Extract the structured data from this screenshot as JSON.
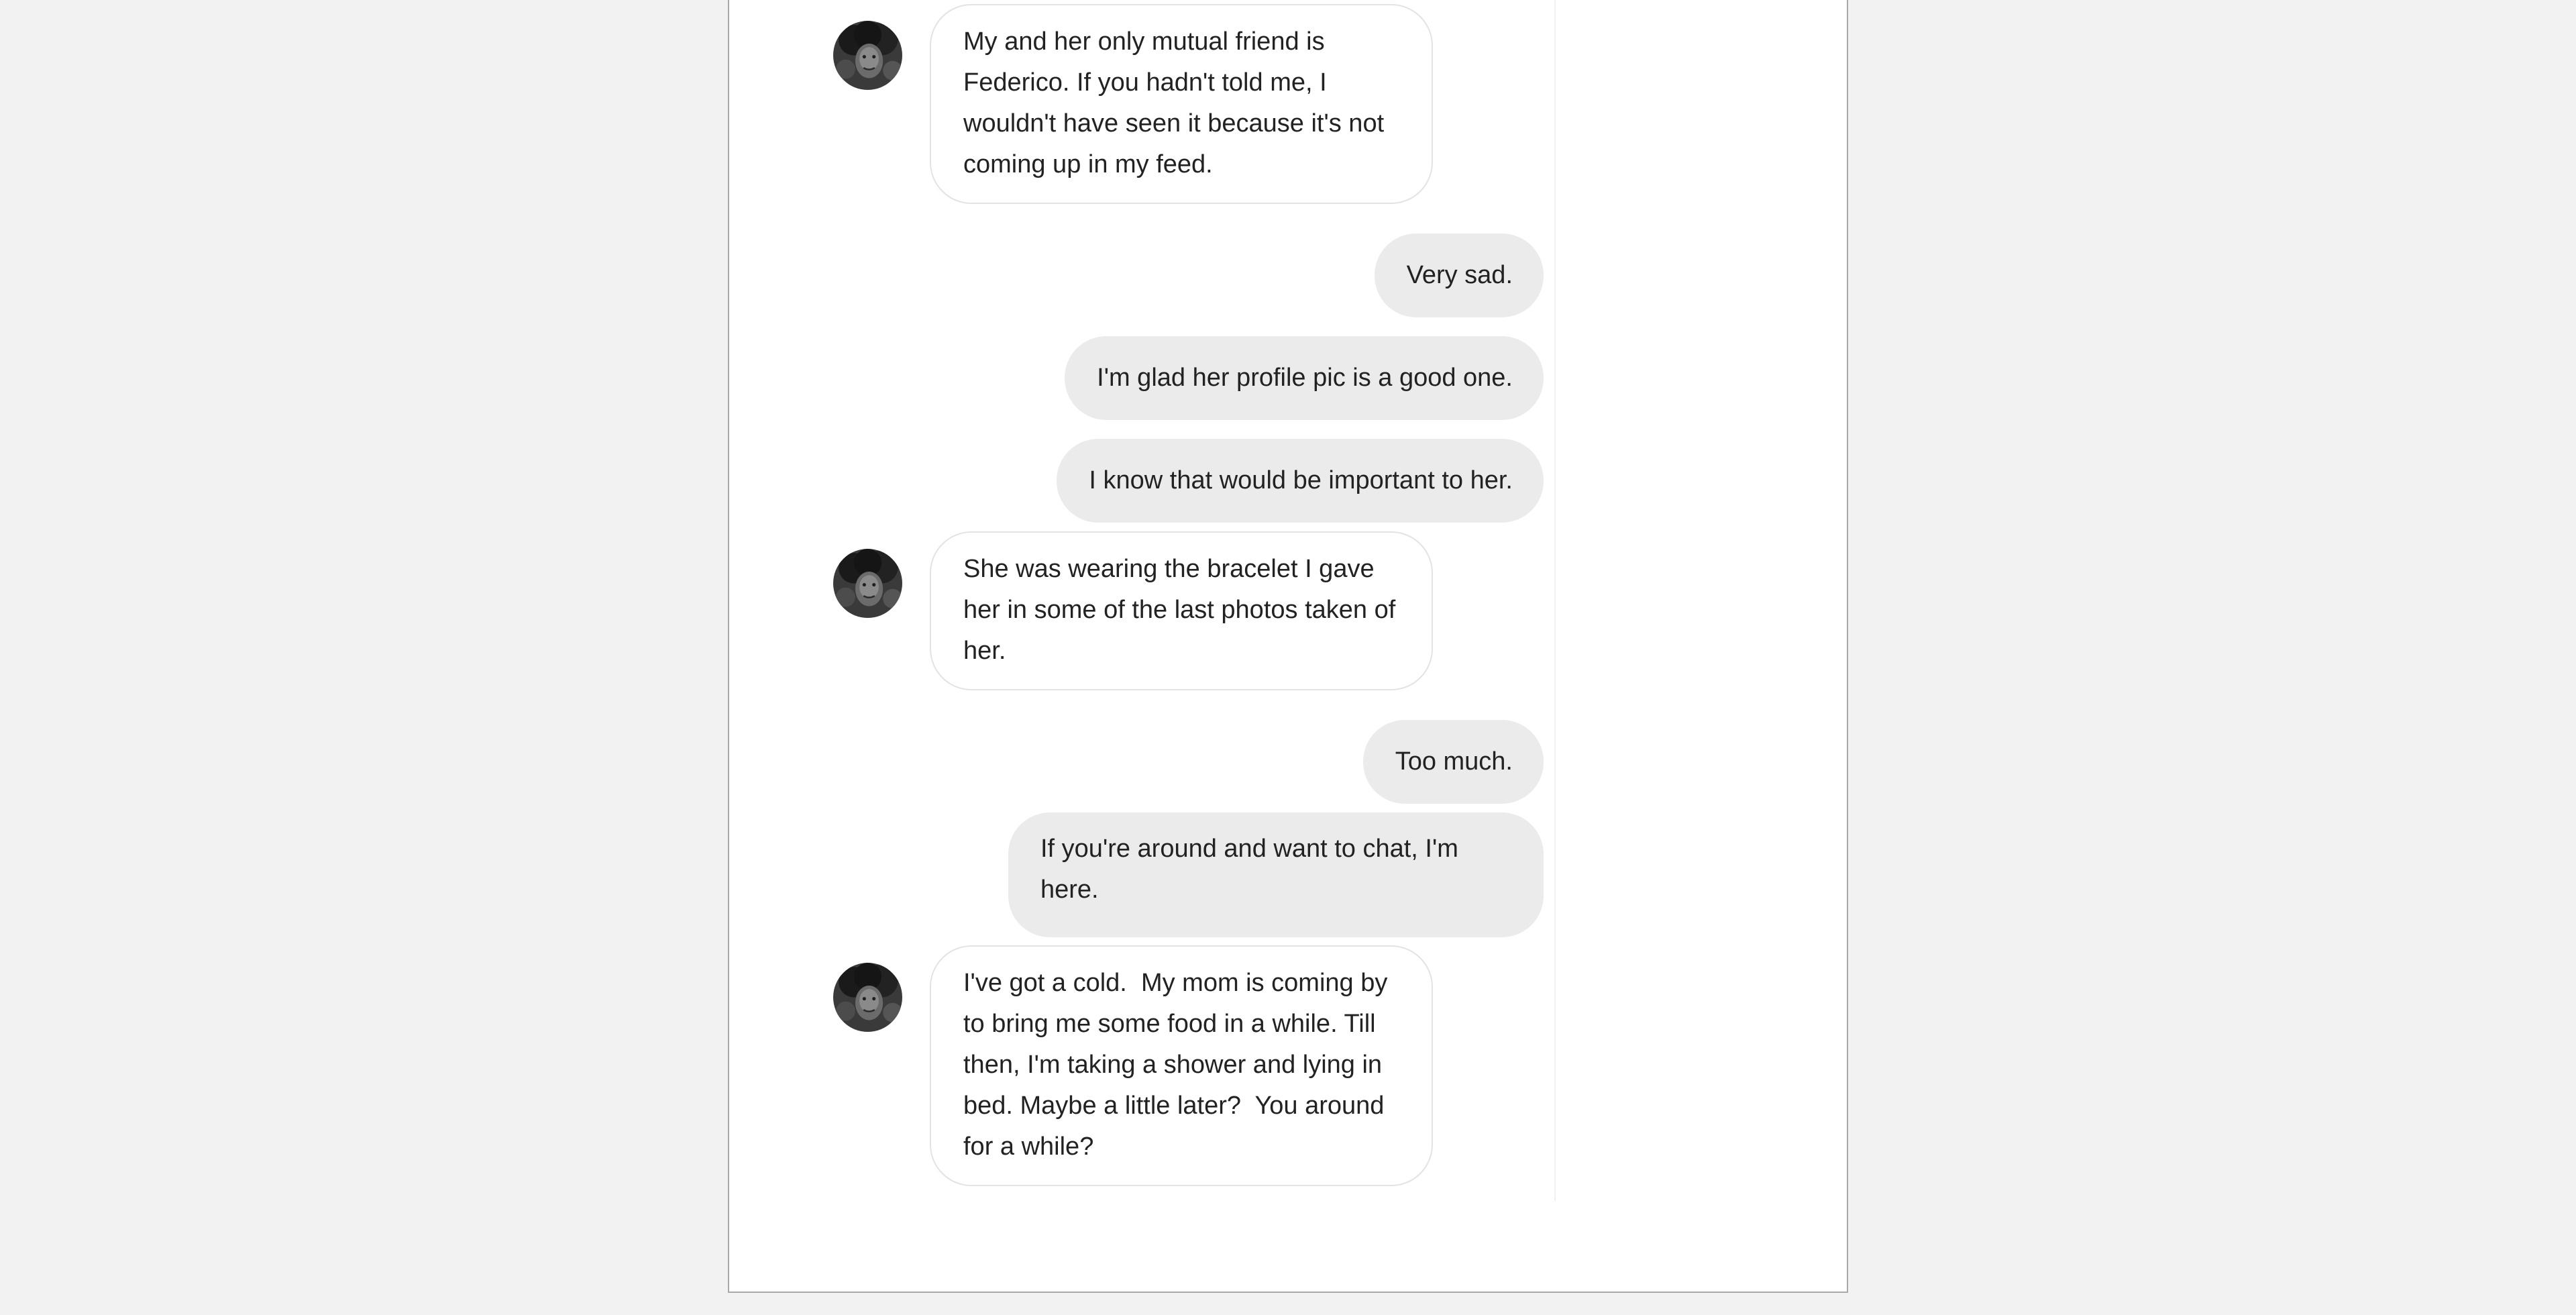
{
  "conversation": {
    "messages": [
      {
        "sender": "contact",
        "text": "My and her only mutual friend is Federico. If you hadn't told me, I wouldn't have seen it because it's not coming up in my feed."
      },
      {
        "sender": "me",
        "text": "Very sad."
      },
      {
        "sender": "me",
        "text": "I'm glad her profile pic is a good one."
      },
      {
        "sender": "me",
        "text": "I know that would be important to her."
      },
      {
        "sender": "contact",
        "text": "She was wearing the bracelet I gave her in some of the last photos taken of her."
      },
      {
        "sender": "me",
        "text": "Too much."
      },
      {
        "sender": "me",
        "text": "If you're around and want to chat, I'm here."
      },
      {
        "sender": "contact",
        "text": "I've got a cold.  My mom is coming by to bring me some food in a while. Till then, I'm taking a shower and lying in bed. Maybe a little later?  You around for a while?"
      }
    ]
  },
  "colors": {
    "page_background": "#f2f2f2",
    "panel_background": "#ffffff",
    "outgoing_bubble": "#ebebeb",
    "incoming_bubble_border": "#e3e3e3",
    "text": "#222222"
  },
  "icons": {
    "avatar": "contact-avatar-photo"
  }
}
